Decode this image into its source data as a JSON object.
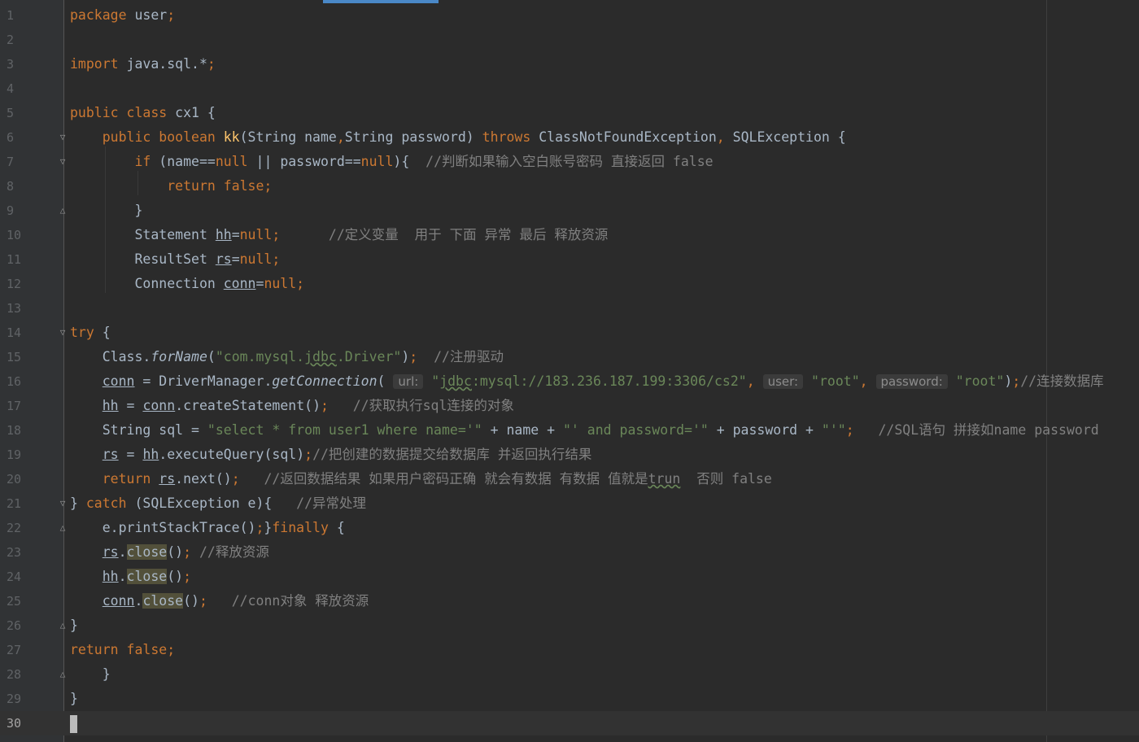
{
  "editor": {
    "lines": [
      {
        "n": "1",
        "tokens": [
          {
            "t": "package ",
            "c": "kw"
          },
          {
            "t": "user"
          },
          {
            "t": ";",
            "c": "kw"
          }
        ]
      },
      {
        "n": "2",
        "tokens": []
      },
      {
        "n": "3",
        "tokens": [
          {
            "t": "import ",
            "c": "kw"
          },
          {
            "t": "java.sql.*"
          },
          {
            "t": ";",
            "c": "kw"
          }
        ]
      },
      {
        "n": "4",
        "tokens": []
      },
      {
        "n": "5",
        "tokens": [
          {
            "t": "public class ",
            "c": "kw"
          },
          {
            "t": "cx1 {"
          }
        ]
      },
      {
        "n": "6",
        "fold": "top",
        "tokens": [
          {
            "t": "    public boolean ",
            "c": "kw"
          },
          {
            "t": "kk",
            "c": "fn"
          },
          {
            "t": "(String name"
          },
          {
            "t": ",",
            "c": "kw"
          },
          {
            "t": "String password) "
          },
          {
            "t": "throws ",
            "c": "kw"
          },
          {
            "t": "ClassNotFoundException"
          },
          {
            "t": ", ",
            "c": "kw"
          },
          {
            "t": "SQLException {"
          }
        ]
      },
      {
        "n": "7",
        "fold": "top",
        "tokens": [
          {
            "t": "        "
          },
          {
            "t": "if ",
            "c": "kw"
          },
          {
            "t": "(name=="
          },
          {
            "t": "null ",
            "c": "kw"
          },
          {
            "t": "|| password=="
          },
          {
            "t": "null",
            "c": "kw"
          },
          {
            "t": "){  "
          },
          {
            "t": "//判断如果输入空白账号密码 直接返回 false",
            "c": "cmt"
          }
        ]
      },
      {
        "n": "8",
        "tokens": [
          {
            "t": "            "
          },
          {
            "t": "return false;",
            "c": "kw"
          }
        ]
      },
      {
        "n": "9",
        "fold": "end",
        "tokens": [
          {
            "t": "        }"
          }
        ]
      },
      {
        "n": "10",
        "tokens": [
          {
            "t": "        Statement "
          },
          {
            "t": "hh",
            "c": "ul"
          },
          {
            "t": "="
          },
          {
            "t": "null;",
            "c": "kw"
          },
          {
            "t": "      "
          },
          {
            "t": "//定义变量  用于 下面 异常 最后 释放资源",
            "c": "cmt"
          }
        ]
      },
      {
        "n": "11",
        "tokens": [
          {
            "t": "        ResultSet "
          },
          {
            "t": "rs",
            "c": "ul"
          },
          {
            "t": "="
          },
          {
            "t": "null;",
            "c": "kw"
          }
        ]
      },
      {
        "n": "12",
        "tokens": [
          {
            "t": "        Connection "
          },
          {
            "t": "conn",
            "c": "ul"
          },
          {
            "t": "="
          },
          {
            "t": "null;",
            "c": "kw"
          }
        ]
      },
      {
        "n": "13",
        "tokens": []
      },
      {
        "n": "14",
        "fold": "top",
        "tokens": [
          {
            "t": "try ",
            "c": "kw"
          },
          {
            "t": "{"
          }
        ]
      },
      {
        "n": "15",
        "tokens": [
          {
            "t": "    Class."
          },
          {
            "t": "forName",
            "c": "it"
          },
          {
            "t": "("
          },
          {
            "t": "\"com.mysql.",
            "c": "str"
          },
          {
            "t": "jdbc",
            "c": "str wavy"
          },
          {
            "t": ".Driver\"",
            "c": "str"
          },
          {
            "t": ")"
          },
          {
            "t": ";",
            "c": "kw"
          },
          {
            "t": "  "
          },
          {
            "t": "//注册驱动",
            "c": "cmt"
          }
        ]
      },
      {
        "n": "16",
        "tokens": [
          {
            "t": "    "
          },
          {
            "t": "conn",
            "c": "ul"
          },
          {
            "t": " = DriverManager."
          },
          {
            "t": "getConnection",
            "c": "it"
          },
          {
            "t": "( "
          },
          {
            "t": "url:",
            "c": "hint"
          },
          {
            "t": " "
          },
          {
            "t": "\"",
            "c": "str"
          },
          {
            "t": "jdbc",
            "c": "str wavy"
          },
          {
            "t": ":mysql://183.236.187.199:3306/cs2\"",
            "c": "str"
          },
          {
            "t": ", ",
            "c": "kw"
          },
          {
            "t": "user:",
            "c": "hint"
          },
          {
            "t": " "
          },
          {
            "t": "\"root\"",
            "c": "str"
          },
          {
            "t": ", ",
            "c": "kw"
          },
          {
            "t": "password:",
            "c": "hint"
          },
          {
            "t": " "
          },
          {
            "t": "\"root\"",
            "c": "str"
          },
          {
            "t": ")"
          },
          {
            "t": ";",
            "c": "kw"
          },
          {
            "t": "//连接数据库",
            "c": "cmt"
          }
        ]
      },
      {
        "n": "17",
        "tokens": [
          {
            "t": "    "
          },
          {
            "t": "hh",
            "c": "ul"
          },
          {
            "t": " = "
          },
          {
            "t": "conn",
            "c": "ul"
          },
          {
            "t": ".createStatement()"
          },
          {
            "t": ";",
            "c": "kw"
          },
          {
            "t": "   "
          },
          {
            "t": "//获取执行sql连接的对象",
            "c": "cmt"
          }
        ]
      },
      {
        "n": "18",
        "tokens": [
          {
            "t": "    String sql = "
          },
          {
            "t": "\"select * from user1 where name='\"",
            "c": "str"
          },
          {
            "t": " + name + "
          },
          {
            "t": "\"' and password='\"",
            "c": "str"
          },
          {
            "t": " + password + "
          },
          {
            "t": "\"'\"",
            "c": "str"
          },
          {
            "t": ";",
            "c": "kw"
          },
          {
            "t": "   "
          },
          {
            "t": "//SQL语句 拼接如name password",
            "c": "cmt"
          }
        ]
      },
      {
        "n": "19",
        "tokens": [
          {
            "t": "    "
          },
          {
            "t": "rs",
            "c": "ul"
          },
          {
            "t": " = "
          },
          {
            "t": "hh",
            "c": "ul"
          },
          {
            "t": ".executeQuery(sql)"
          },
          {
            "t": ";",
            "c": "kw"
          },
          {
            "t": "//把创建的数据提交给数据库 并返回执行结果",
            "c": "cmt"
          }
        ]
      },
      {
        "n": "20",
        "tokens": [
          {
            "t": "    "
          },
          {
            "t": "return ",
            "c": "kw"
          },
          {
            "t": "rs",
            "c": "ul"
          },
          {
            "t": ".next()"
          },
          {
            "t": ";",
            "c": "kw"
          },
          {
            "t": "   "
          },
          {
            "t": "//返回数据结果 如果用户密码正确 就会有数据 有数据 值就是",
            "c": "cmt"
          },
          {
            "t": "trun",
            "c": "cmt wavy"
          },
          {
            "t": "  否则 false",
            "c": "cmt"
          }
        ]
      },
      {
        "n": "21",
        "fold": "top",
        "tokens": [
          {
            "t": "} "
          },
          {
            "t": "catch ",
            "c": "kw"
          },
          {
            "t": "(SQLException e){   "
          },
          {
            "t": "//异常处理",
            "c": "cmt"
          }
        ]
      },
      {
        "n": "22",
        "fold": "end",
        "tokens": [
          {
            "t": "    e.printStackTrace()"
          },
          {
            "t": ";",
            "c": "kw"
          },
          {
            "t": "}"
          },
          {
            "t": "finally ",
            "c": "kw"
          },
          {
            "t": "{"
          }
        ]
      },
      {
        "n": "23",
        "tokens": [
          {
            "t": "    "
          },
          {
            "t": "rs",
            "c": "ul"
          },
          {
            "t": "."
          },
          {
            "t": "close",
            "c": "hl"
          },
          {
            "t": "()"
          },
          {
            "t": "; ",
            "c": "kw"
          },
          {
            "t": "//释放资源",
            "c": "cmt"
          }
        ]
      },
      {
        "n": "24",
        "tokens": [
          {
            "t": "    "
          },
          {
            "t": "hh",
            "c": "ul"
          },
          {
            "t": "."
          },
          {
            "t": "close",
            "c": "hl"
          },
          {
            "t": "()"
          },
          {
            "t": ";",
            "c": "kw"
          }
        ]
      },
      {
        "n": "25",
        "tokens": [
          {
            "t": "    "
          },
          {
            "t": "conn",
            "c": "ul"
          },
          {
            "t": "."
          },
          {
            "t": "close",
            "c": "hl"
          },
          {
            "t": "()"
          },
          {
            "t": ";",
            "c": "kw"
          },
          {
            "t": "   "
          },
          {
            "t": "//conn对象 释放资源",
            "c": "cmt"
          }
        ]
      },
      {
        "n": "26",
        "fold": "end",
        "tokens": [
          {
            "t": "}"
          }
        ]
      },
      {
        "n": "27",
        "tokens": [
          {
            "t": "return false;",
            "c": "kw"
          }
        ]
      },
      {
        "n": "28",
        "fold": "end",
        "tokens": [
          {
            "t": "    }"
          }
        ]
      },
      {
        "n": "29",
        "tokens": [
          {
            "t": "}"
          }
        ]
      },
      {
        "n": "30",
        "current": true,
        "caret": true,
        "tokens": []
      }
    ]
  }
}
